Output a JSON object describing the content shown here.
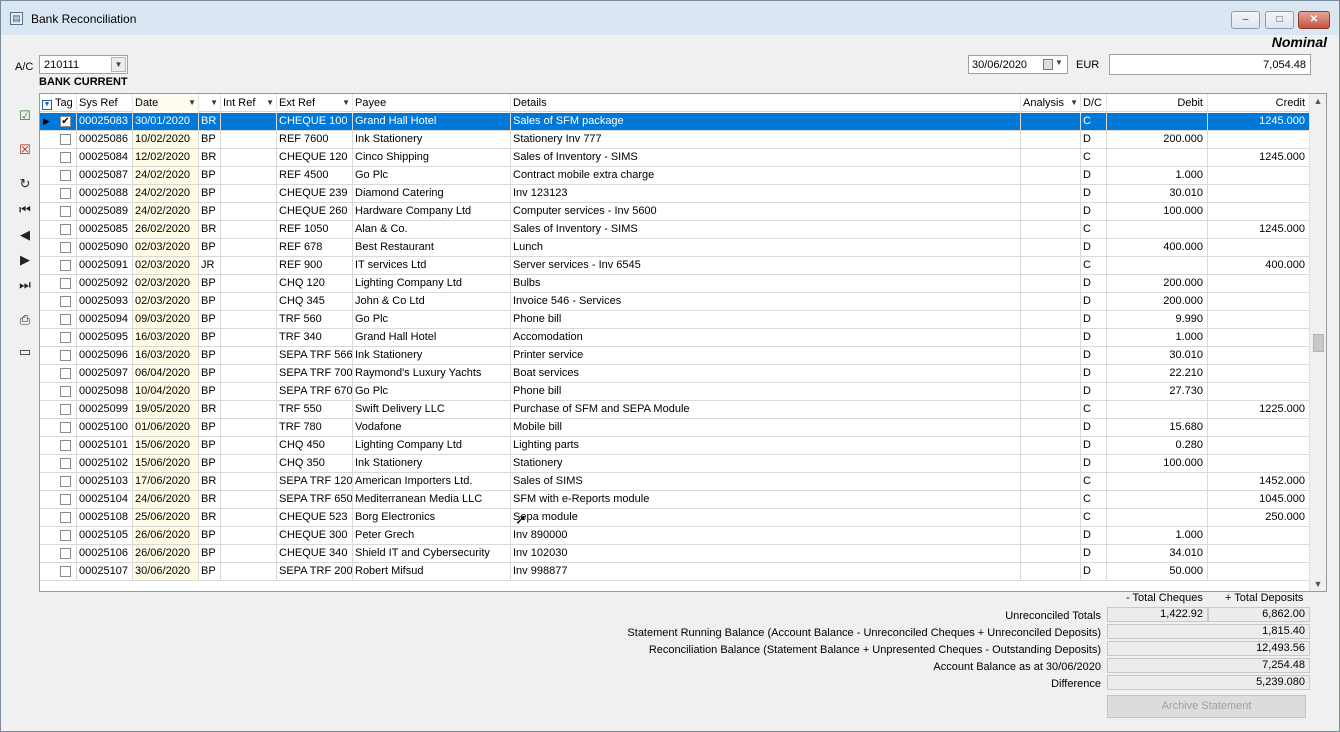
{
  "window": {
    "title": "Bank Reconciliation",
    "minimize": "–",
    "maximize": "□",
    "close": "✕"
  },
  "header": {
    "nominal": "Nominal",
    "ac_label": "A/C",
    "ac_value": "210111",
    "ac_name": "BANK CURRENT",
    "date_value": "30/06/2020",
    "currency": "EUR",
    "balance": "7,054.48"
  },
  "toolbar_icons": [
    "tag-all-icon",
    "untag-all-icon",
    "refresh-icon",
    "first-record-icon",
    "previous-record-icon",
    "next-record-icon",
    "last-record-icon",
    "print-icon",
    "export-icon"
  ],
  "columns": {
    "tag": "Tag",
    "sysref": "Sys Ref",
    "date": "Date",
    "type": "",
    "intref": "Int Ref",
    "extref": "Ext Ref",
    "payee": "Payee",
    "details": "Details",
    "analysis": "Analysis",
    "dc": "D/C",
    "debit": "Debit",
    "credit": "Credit"
  },
  "rows": [
    {
      "tag": true,
      "sysref": "00025083",
      "date": "30/01/2020",
      "type": "BR",
      "intref": "",
      "extref": "CHEQUE 100",
      "payee": "Grand Hall Hotel",
      "details": "Sales of SFM package",
      "analysis": "",
      "dc": "C",
      "debit": "",
      "credit": "1245.000"
    },
    {
      "tag": false,
      "sysref": "00025086",
      "date": "10/02/2020",
      "type": "BP",
      "intref": "",
      "extref": "REF 7600",
      "payee": "Ink Stationery",
      "details": "Stationery Inv 777",
      "analysis": "",
      "dc": "D",
      "debit": "200.000",
      "credit": ""
    },
    {
      "tag": false,
      "sysref": "00025084",
      "date": "12/02/2020",
      "type": "BR",
      "intref": "",
      "extref": "CHEQUE 120",
      "payee": "Cinco Shipping",
      "details": "Sales of Inventory - SIMS",
      "analysis": "",
      "dc": "C",
      "debit": "",
      "credit": "1245.000"
    },
    {
      "tag": false,
      "sysref": "00025087",
      "date": "24/02/2020",
      "type": "BP",
      "intref": "",
      "extref": "REF 4500",
      "payee": "Go Plc",
      "details": "Contract mobile extra charge",
      "analysis": "",
      "dc": "D",
      "debit": "1.000",
      "credit": ""
    },
    {
      "tag": false,
      "sysref": "00025088",
      "date": "24/02/2020",
      "type": "BP",
      "intref": "",
      "extref": "CHEQUE 239",
      "payee": "Diamond Catering",
      "details": "Inv 123123",
      "analysis": "",
      "dc": "D",
      "debit": "30.010",
      "credit": ""
    },
    {
      "tag": false,
      "sysref": "00025089",
      "date": "24/02/2020",
      "type": "BP",
      "intref": "",
      "extref": "CHEQUE 260",
      "payee": "Hardware Company Ltd",
      "details": "Computer services - Inv 5600",
      "analysis": "",
      "dc": "D",
      "debit": "100.000",
      "credit": ""
    },
    {
      "tag": false,
      "sysref": "00025085",
      "date": "26/02/2020",
      "type": "BR",
      "intref": "",
      "extref": "REF 1050",
      "payee": "Alan & Co.",
      "details": "Sales of Inventory - SIMS",
      "analysis": "",
      "dc": "C",
      "debit": "",
      "credit": "1245.000"
    },
    {
      "tag": false,
      "sysref": "00025090",
      "date": "02/03/2020",
      "type": "BP",
      "intref": "",
      "extref": "REF 678",
      "payee": "Best Restaurant",
      "details": "Lunch",
      "analysis": "",
      "dc": "D",
      "debit": "400.000",
      "credit": ""
    },
    {
      "tag": false,
      "sysref": "00025091",
      "date": "02/03/2020",
      "type": "JR",
      "intref": "",
      "extref": "REF 900",
      "payee": "IT services Ltd",
      "details": "Server services - Inv 6545",
      "analysis": "",
      "dc": "C",
      "debit": "",
      "credit": "400.000"
    },
    {
      "tag": false,
      "sysref": "00025092",
      "date": "02/03/2020",
      "type": "BP",
      "intref": "",
      "extref": "CHQ 120",
      "payee": "Lighting Company Ltd",
      "details": "Bulbs",
      "analysis": "",
      "dc": "D",
      "debit": "200.000",
      "credit": ""
    },
    {
      "tag": false,
      "sysref": "00025093",
      "date": "02/03/2020",
      "type": "BP",
      "intref": "",
      "extref": "CHQ 345",
      "payee": "John & Co Ltd",
      "details": "Invoice 546 - Services",
      "analysis": "",
      "dc": "D",
      "debit": "200.000",
      "credit": ""
    },
    {
      "tag": false,
      "sysref": "00025094",
      "date": "09/03/2020",
      "type": "BP",
      "intref": "",
      "extref": "TRF 560",
      "payee": "Go Plc",
      "details": "Phone bill",
      "analysis": "",
      "dc": "D",
      "debit": "9.990",
      "credit": ""
    },
    {
      "tag": false,
      "sysref": "00025095",
      "date": "16/03/2020",
      "type": "BP",
      "intref": "",
      "extref": "TRF 340",
      "payee": "Grand Hall Hotel",
      "details": "Accomodation",
      "analysis": "",
      "dc": "D",
      "debit": "1.000",
      "credit": ""
    },
    {
      "tag": false,
      "sysref": "00025096",
      "date": "16/03/2020",
      "type": "BP",
      "intref": "",
      "extref": "SEPA TRF 566",
      "payee": "Ink Stationery",
      "details": "Printer service",
      "analysis": "",
      "dc": "D",
      "debit": "30.010",
      "credit": ""
    },
    {
      "tag": false,
      "sysref": "00025097",
      "date": "06/04/2020",
      "type": "BP",
      "intref": "",
      "extref": "SEPA TRF 700",
      "payee": "Raymond's Luxury Yachts",
      "details": "Boat services",
      "analysis": "",
      "dc": "D",
      "debit": "22.210",
      "credit": ""
    },
    {
      "tag": false,
      "sysref": "00025098",
      "date": "10/04/2020",
      "type": "BP",
      "intref": "",
      "extref": "SEPA TRF 670",
      "payee": "Go Plc",
      "details": "Phone bill",
      "analysis": "",
      "dc": "D",
      "debit": "27.730",
      "credit": ""
    },
    {
      "tag": false,
      "sysref": "00025099",
      "date": "19/05/2020",
      "type": "BR",
      "intref": "",
      "extref": "TRF 550",
      "payee": "Swift Delivery LLC",
      "details": "Purchase of SFM and SEPA Module",
      "analysis": "",
      "dc": "C",
      "debit": "",
      "credit": "1225.000"
    },
    {
      "tag": false,
      "sysref": "00025100",
      "date": "01/06/2020",
      "type": "BP",
      "intref": "",
      "extref": "TRF 780",
      "payee": "Vodafone",
      "details": "Mobile bill",
      "analysis": "",
      "dc": "D",
      "debit": "15.680",
      "credit": ""
    },
    {
      "tag": false,
      "sysref": "00025101",
      "date": "15/06/2020",
      "type": "BP",
      "intref": "",
      "extref": "CHQ 450",
      "payee": "Lighting Company Ltd",
      "details": "Lighting parts",
      "analysis": "",
      "dc": "D",
      "debit": "0.280",
      "credit": ""
    },
    {
      "tag": false,
      "sysref": "00025102",
      "date": "15/06/2020",
      "type": "BP",
      "intref": "",
      "extref": "CHQ 350",
      "payee": "Ink Stationery",
      "details": "Stationery",
      "analysis": "",
      "dc": "D",
      "debit": "100.000",
      "credit": ""
    },
    {
      "tag": false,
      "sysref": "00025103",
      "date": "17/06/2020",
      "type": "BR",
      "intref": "",
      "extref": "SEPA TRF 120",
      "payee": "American Importers Ltd.",
      "details": "Sales of SIMS",
      "analysis": "",
      "dc": "C",
      "debit": "",
      "credit": "1452.000"
    },
    {
      "tag": false,
      "sysref": "00025104",
      "date": "24/06/2020",
      "type": "BR",
      "intref": "",
      "extref": "SEPA TRF 650",
      "payee": "Mediterranean Media LLC",
      "details": "SFM with e-Reports module",
      "analysis": "",
      "dc": "C",
      "debit": "",
      "credit": "1045.000"
    },
    {
      "tag": false,
      "sysref": "00025108",
      "date": "25/06/2020",
      "type": "BR",
      "intref": "",
      "extref": "CHEQUE 523",
      "payee": "Borg Electronics",
      "details": "Sepa module",
      "analysis": "",
      "dc": "C",
      "debit": "",
      "credit": "250.000"
    },
    {
      "tag": false,
      "sysref": "00025105",
      "date": "26/06/2020",
      "type": "BP",
      "intref": "",
      "extref": "CHEQUE 300",
      "payee": "Peter Grech",
      "details": "Inv 890000",
      "analysis": "",
      "dc": "D",
      "debit": "1.000",
      "credit": ""
    },
    {
      "tag": false,
      "sysref": "00025106",
      "date": "26/06/2020",
      "type": "BP",
      "intref": "",
      "extref": "CHEQUE 340",
      "payee": "Shield IT and Cybersecurity",
      "details": "Inv 102030",
      "analysis": "",
      "dc": "D",
      "debit": "34.010",
      "credit": ""
    },
    {
      "tag": false,
      "sysref": "00025107",
      "date": "30/06/2020",
      "type": "BP",
      "intref": "",
      "extref": "SEPA TRF 200",
      "payee": "Robert Mifsud",
      "details": "Inv 998877",
      "analysis": "",
      "dc": "D",
      "debit": "50.000",
      "credit": ""
    }
  ],
  "summary": {
    "total_cheques_header": "- Total  Cheques",
    "total_deposits_header": "+ Total  Deposits",
    "unreconciled_label": "Unreconciled Totals",
    "unreconciled_cheques": "1,422.92",
    "unreconciled_deposits": "6,862.00",
    "statement_running_label": "Statement Running Balance (Account Balance - Unreconciled Cheques + Unreconciled Deposits)",
    "statement_running_value": "1,815.40",
    "reconciliation_label": "Reconciliation Balance (Statement Balance + Unpresented Cheques - Outstanding Deposits)",
    "reconciliation_value": "12,493.56",
    "account_balance_label": "Account Balance as at 30/06/2020",
    "account_balance_value": "7,254.48",
    "difference_label": "Difference",
    "difference_value": "5,239.080",
    "archive_button": "Archive Statement"
  }
}
